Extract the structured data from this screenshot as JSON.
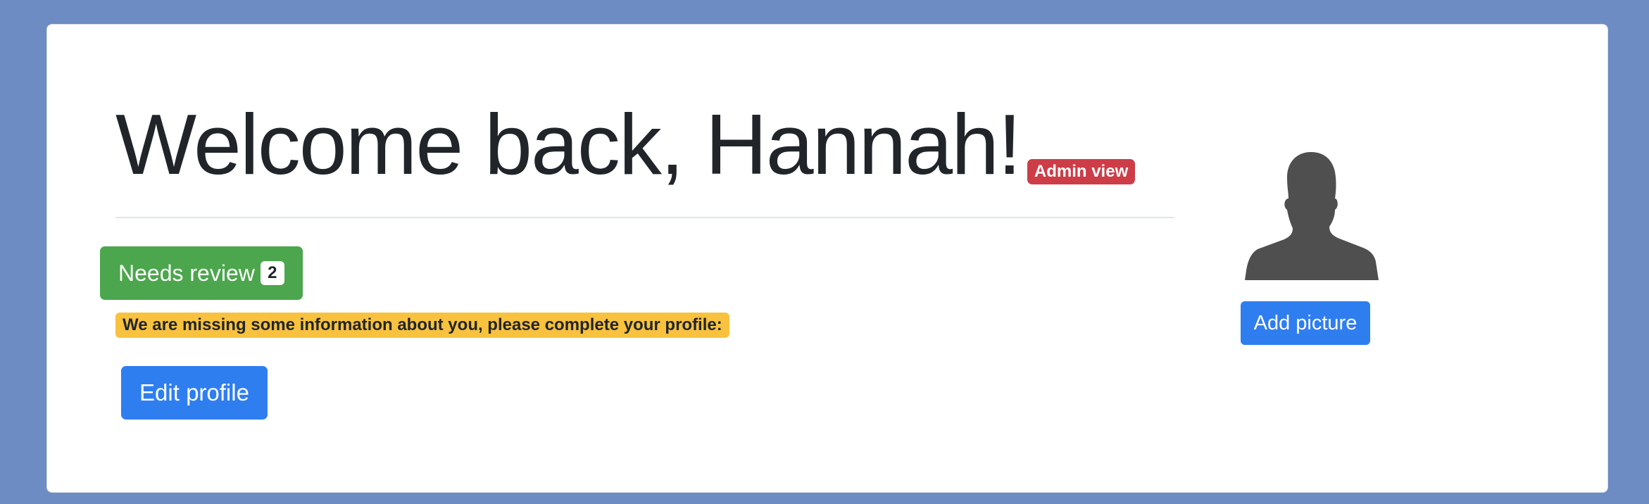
{
  "header": {
    "title": "Welcome back, Hannah!",
    "role_badge": "Admin view"
  },
  "review": {
    "label": "Needs review",
    "count": "2"
  },
  "profile": {
    "missing_info_notice": "We are missing some information about you, please complete your profile:",
    "edit_label": "Edit profile"
  },
  "avatar": {
    "icon": "user-silhouette-icon",
    "add_picture_label": "Add picture"
  },
  "colors": {
    "page_background": "#6c8cc3",
    "admin_badge": "#cc3d48",
    "review_button": "#4ca64d",
    "warning_badge": "#f8c23e",
    "primary_button": "#2f7ef0",
    "avatar_fill": "#4f4f4f"
  }
}
